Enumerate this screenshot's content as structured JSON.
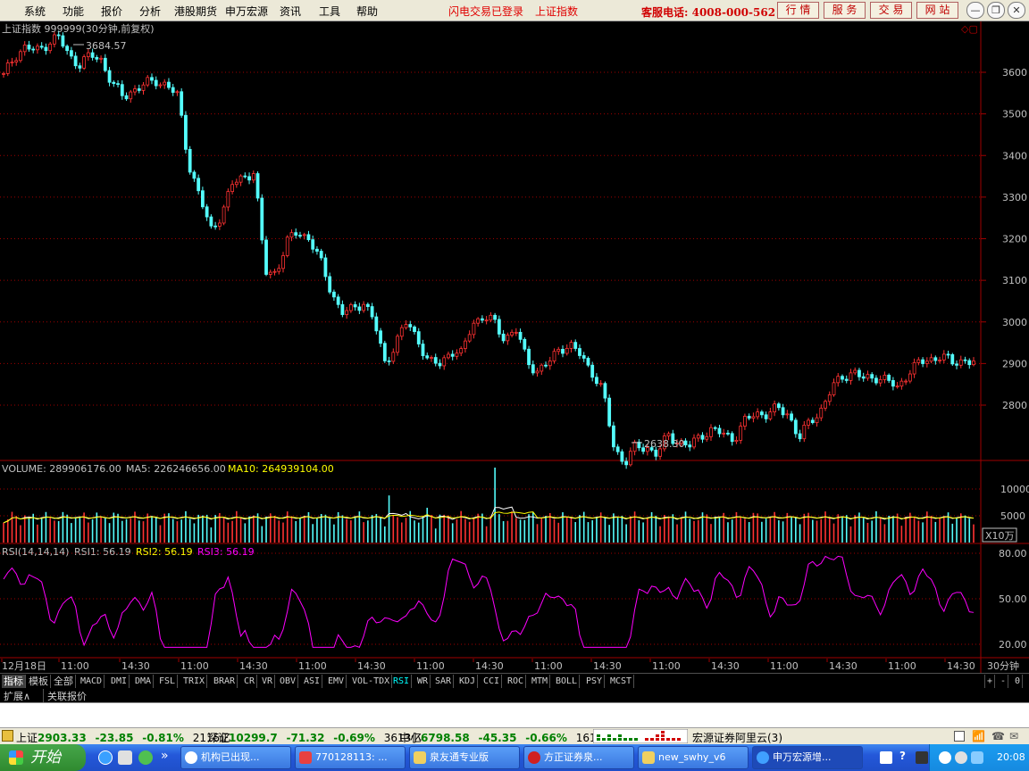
{
  "menubar": {
    "items": [
      "系统",
      "功能",
      "报价",
      "分析",
      "港股期货",
      "申万宏源",
      "资讯",
      "工具",
      "帮助"
    ],
    "status": "闪电交易已登录",
    "index_name": "上证指数",
    "hotline": "客服电话: 4008-000-562",
    "quick_buttons": [
      "行 情",
      "服 务",
      "交 易",
      "网 站"
    ]
  },
  "price_panel": {
    "title": "上证指数 999999(30分钟,前复权)",
    "high_label": "3684.57",
    "low_label": "2638.30",
    "y_ticks": [
      "3600",
      "3500",
      "3400",
      "3300",
      "3200",
      "3100",
      "3000",
      "2900",
      "2800"
    ]
  },
  "volume_panel": {
    "label": "VOLUME: 289906176.00",
    "ma5": "MA5: 226246656.00",
    "ma10": "MA10: 264939104.00",
    "y_ticks": [
      "10000",
      "5000"
    ],
    "unit": "X10万"
  },
  "rsi_panel": {
    "label": "RSI(14,14,14)",
    "rsi1": "RSI1: 56.19",
    "rsi2": "RSI2: 56.19",
    "rsi3": "RSI3: 56.19",
    "y_ticks": [
      "80.00",
      "50.00",
      "20.00"
    ]
  },
  "x_axis": {
    "labels": [
      "12月18日",
      "11:00",
      "14:30",
      "11:00",
      "14:30",
      "11:00",
      "14:30",
      "11:00",
      "14:30",
      "11:00",
      "14:30",
      "11:00",
      "14:30",
      "11:00",
      "14:30",
      "11:00",
      "14:30"
    ],
    "period": "30分钟",
    "controls": [
      "+",
      "-",
      "0"
    ]
  },
  "indicator_tabs": [
    "指标",
    "模板",
    "全部",
    "MACD",
    "DMI",
    "DMA",
    "FSL",
    "TRIX",
    "BRAR",
    "CR",
    "VR",
    "OBV",
    "ASI",
    "EMV",
    "VOL-TDX",
    "RSI",
    "WR",
    "SAR",
    "KDJ",
    "CCI",
    "ROC",
    "MTM",
    "BOLL",
    "PSY",
    "MCST"
  ],
  "active_tab": "RSI",
  "extra_tabs": [
    "扩展∧",
    "关联报价"
  ],
  "index_bar": {
    "sh_label": "上证",
    "sh_value": "2903.33",
    "sh_change": "-23.85",
    "sh_pct": "-0.81%",
    "sh_amount": "2115亿",
    "sz_label": "深证",
    "sz_value": "10299.7",
    "sz_change": "-71.32",
    "sz_pct": "-0.69%",
    "sz_amount": "3613亿",
    "sme_label": "中小",
    "sme_value": "6798.58",
    "sme_change": "-45.35",
    "sme_pct": "-0.66%",
    "sme_amount": "1616亿",
    "broker": "宏源证券阿里云(3)"
  },
  "taskbar": {
    "start": "开始",
    "buttons": [
      "机构已出现...",
      "770128113: ...",
      "泉友通专业版",
      "方正证券泉...",
      "new_swhy_v6",
      "申万宏源增..."
    ],
    "clock": "20:08"
  },
  "chart_data": {
    "type": "candlestick",
    "title": "上证指数 999999(30分钟,前复权)",
    "ylim": [
      2600,
      3720
    ],
    "close_series_approx": [
      3590,
      3640,
      3660,
      3650,
      3670,
      3685,
      3640,
      3620,
      3640,
      3630,
      3570,
      3540,
      3560,
      3570,
      3580,
      3570,
      3540,
      3380,
      3300,
      3220,
      3260,
      3330,
      3350,
      3360,
      3120,
      3120,
      3190,
      3220,
      3200,
      3150,
      3080,
      3020,
      3030,
      3050,
      3000,
      2900,
      2950,
      3000,
      2960,
      2900,
      2900,
      2930,
      2920,
      3000,
      3010,
      3000,
      2960,
      2980,
      2910,
      2880,
      2900,
      2940,
      2940,
      2920,
      2880,
      2830,
      2700,
      2660,
      2700,
      2700,
      2680,
      2730,
      2710,
      2700,
      2730,
      2740,
      2730,
      2720,
      2760,
      2780,
      2780,
      2790,
      2780,
      2720,
      2760,
      2790,
      2840,
      2870,
      2880,
      2860,
      2870,
      2860,
      2840,
      2880,
      2900,
      2910,
      2920,
      2900,
      2910,
      2903
    ],
    "volume_ticks": [
      10000,
      5000
    ],
    "volume_unit": "X10万",
    "rsi": {
      "params": "14,14,14",
      "rsi1": 56.19,
      "rsi2": 56.19,
      "rsi3": 56.19,
      "ylim": [
        15,
        85
      ],
      "ticks": [
        80,
        50,
        20
      ]
    }
  }
}
